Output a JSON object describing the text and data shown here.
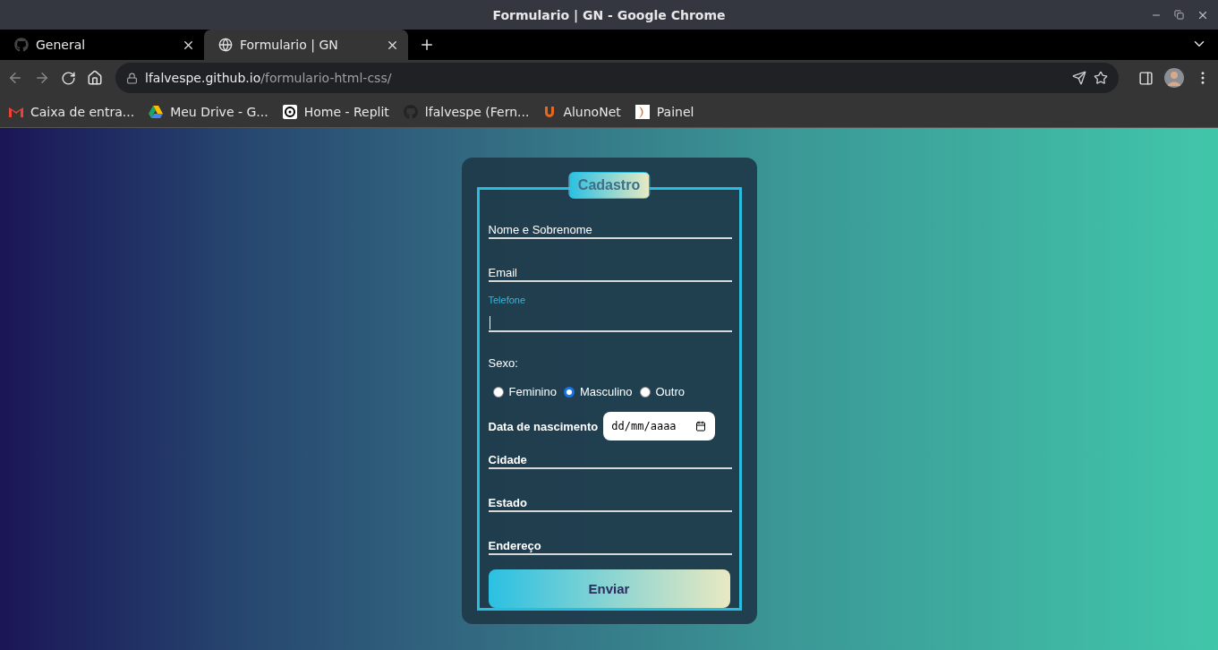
{
  "window": {
    "title": "Formulario | GN - Google Chrome"
  },
  "tabs": [
    {
      "label": "General",
      "selected": false,
      "kind": "github"
    },
    {
      "label": "Formulario | GN",
      "selected": true,
      "kind": "globe"
    }
  ],
  "address": {
    "host": "lfalvespe.github.io",
    "path": "/formulario-html-css/"
  },
  "bookmarks": [
    {
      "label": "Caixa de entra...",
      "kind": "mail"
    },
    {
      "label": "Meu Drive - G...",
      "kind": "drive"
    },
    {
      "label": "Home - Replit",
      "kind": "replit"
    },
    {
      "label": "lfalvespe (Fern...",
      "kind": "github"
    },
    {
      "label": "AlunoNet",
      "kind": "aluno"
    },
    {
      "label": "Painel",
      "kind": "painel"
    }
  ],
  "form": {
    "legend": "Cadastro",
    "fields_top": [
      {
        "label": "Nome e Sobrenome",
        "focused": false
      },
      {
        "label": "Email",
        "focused": false
      },
      {
        "label": "Telefone",
        "focused": true
      }
    ],
    "gender_label": "Sexo:",
    "radios": [
      {
        "label": "Feminino",
        "selected": false
      },
      {
        "label": "Masculino",
        "selected": true
      },
      {
        "label": "Outro",
        "selected": false
      }
    ],
    "date": {
      "label": "Data de nascimento",
      "placeholder": "dd/mm/aaaa"
    },
    "fields_bottom": [
      {
        "label": "Cidade",
        "focused": false
      },
      {
        "label": "Estado",
        "focused": false
      },
      {
        "label": "Endereço",
        "focused": false
      }
    ],
    "submit": "Enviar"
  }
}
